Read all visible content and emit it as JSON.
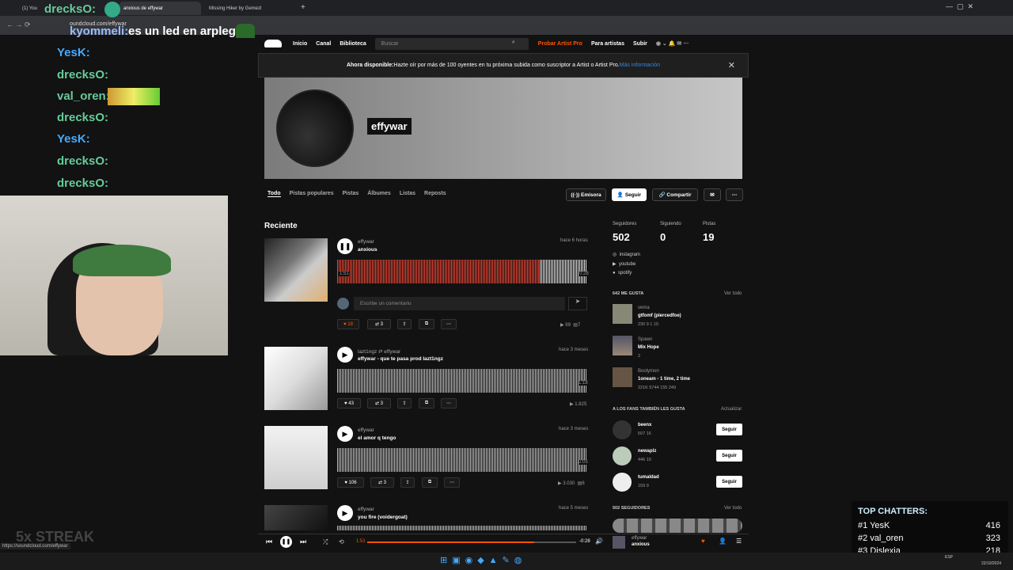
{
  "browser": {
    "tabs": [
      "(1) You",
      "anxious de effywar",
      "Missing Hiker by Gemezl"
    ],
    "url": "oundcloud.com/effywar",
    "status_url": "https://soundcloud.com/effywar"
  },
  "chat": {
    "messages": [
      {
        "user": "drecksO:",
        "text": "",
        "user_display": "drecksO:"
      },
      {
        "user": "kyommeli:",
        "text": "es un led en arplegio"
      },
      {
        "user": "YesK:",
        "text": ""
      },
      {
        "user": "drecksO:",
        "text": ""
      },
      {
        "user": "val_oren:",
        "text": ""
      },
      {
        "user": "drecksO:",
        "text": ""
      },
      {
        "user": "YesK:",
        "text": ""
      },
      {
        "user": "drecksO:",
        "text": ""
      },
      {
        "user": "drecksO:",
        "text": ""
      }
    ],
    "streak": "5x STREAK"
  },
  "nav": {
    "items": [
      "Inicio",
      "Canal",
      "Biblioteca"
    ],
    "search": "Buscar",
    "pro": "Probar Artist Pro",
    "artists": "Para artistas",
    "upload": "Subir"
  },
  "banner": {
    "bold": "Ahora disponible:",
    "text": " Hazte oír por más de 100 oyentes en tu próxima subida como suscriptor a Artist o Artist Pro. ",
    "link": "Más información"
  },
  "profile": {
    "name": "effywar"
  },
  "tabs": [
    "Todo",
    "Pistas populares",
    "Pistas",
    "Álbumes",
    "Listas",
    "Reposts"
  ],
  "actions": {
    "station": "Emisora",
    "follow": "Seguir",
    "share": "Compartir"
  },
  "section": "Reciente",
  "tracks": [
    {
      "user": "effywar",
      "title": "anxious",
      "time": "hace 6 horas",
      "likes": "18",
      "reposts": "3",
      "plays": "99",
      "comments": "7",
      "start": "1:51",
      "end": "0:28"
    },
    {
      "user": "lazt1ngz",
      "repost": "effywar",
      "title": "effywar - que te pasa prod lazt1ngz",
      "time": "hace 3 meses",
      "likes": "43",
      "reposts": "3",
      "plays": "1.825",
      "end": "1:18"
    },
    {
      "user": "effywar",
      "title": "el amor q tengo",
      "time": "hace 3 meses",
      "likes": "106",
      "reposts": "3",
      "plays": "3.030",
      "comments": "6",
      "end": "2:05"
    },
    {
      "user": "effywar",
      "title": "you fire (voidergoat)",
      "time": "hace 5 meses"
    }
  ],
  "comment_placeholder": "Escribe un comentario",
  "stats": {
    "labels": [
      "Seguidores",
      "Siguiendo",
      "Pistas"
    ],
    "values": [
      "502",
      "0",
      "19"
    ]
  },
  "links": [
    "instagram",
    "youtube",
    "spotify"
  ],
  "likes": {
    "header": "642 ME GUSTA",
    "see_all": "Ver todo",
    "items": [
      {
        "user": "vema",
        "title": "gtfomf (piercedfoe)",
        "stats": "230  9  1  10"
      },
      {
        "user": "Spawn",
        "title": "Mix Hope",
        "stats": "2"
      },
      {
        "user": "Boolymon",
        "title": "1oneam - 1 time, 2 time",
        "stats": "221K  5744  155  249"
      }
    ]
  },
  "fans": {
    "header": "A LOS FANS TAMBIÉN LES GUSTA",
    "refresh": "Actualizar",
    "items": [
      {
        "user": "beenx",
        "stats": "507  16"
      },
      {
        "user": "newaplz",
        "stats": "446  10"
      },
      {
        "user": "tumaldad",
        "stats": "159  9"
      }
    ]
  },
  "followers": {
    "header": "502 SEGUIDORES",
    "see_all": "Ver todo"
  },
  "player": {
    "start": "1:51",
    "end": "-0:28",
    "progress": 0.8,
    "user": "effywar",
    "title": "anxious"
  },
  "top_chatters": {
    "title": "TOP CHATTERS:",
    "rows": [
      {
        "rank": "#1",
        "name": "YesK",
        "count": "416"
      },
      {
        "rank": "#2",
        "name": "val_oren",
        "count": "323"
      },
      {
        "rank": "#3",
        "name": "Dislexia",
        "count": "218"
      }
    ]
  },
  "taskbar": {
    "lang": "ESP",
    "date": "22/10/2024"
  }
}
